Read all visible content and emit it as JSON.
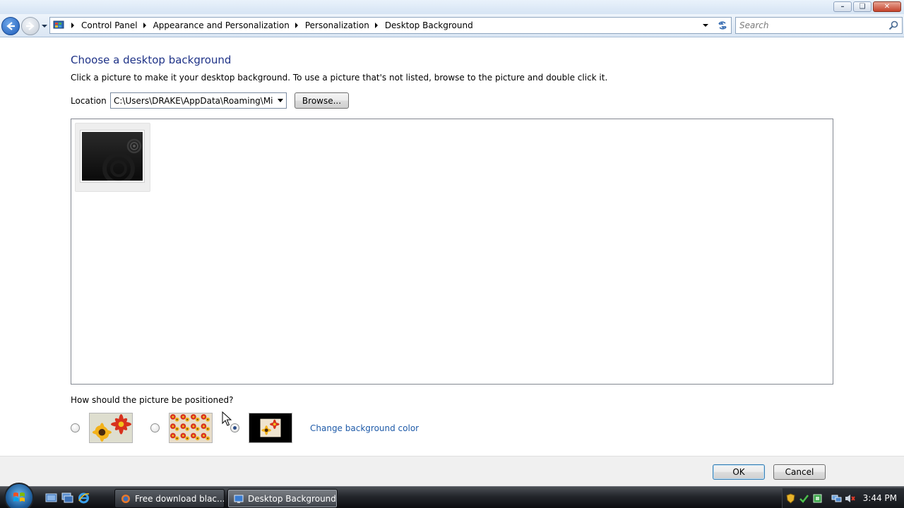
{
  "window": {
    "caption_buttons": [
      "minimize",
      "maximize",
      "close"
    ]
  },
  "navbar": {
    "breadcrumbs": [
      "Control Panel",
      "Appearance and Personalization",
      "Personalization",
      "Desktop Background"
    ],
    "search_placeholder": "Search"
  },
  "content": {
    "heading": "Choose a desktop background",
    "description": "Click a picture to make it your desktop background. To use a picture that's not listed, browse to the picture and double click it.",
    "location_label": "Location",
    "location_value": "C:\\Users\\DRAKE\\AppData\\Roaming\\Micro",
    "browse_label": "Browse...",
    "thumbnails": [
      {
        "name": "dark-circles-wallpaper",
        "selected": false
      }
    ],
    "position_question": "How should the picture be positioned?",
    "position_options": [
      {
        "icon": "fit-to-screen-icon",
        "checked": false
      },
      {
        "icon": "tile-icon",
        "checked": false
      },
      {
        "icon": "center-icon",
        "checked": true
      }
    ],
    "change_color_label": "Change background color"
  },
  "footer": {
    "ok_label": "OK",
    "cancel_label": "Cancel"
  },
  "taskbar": {
    "tasks": [
      {
        "label": "Free download blac...",
        "active": false
      },
      {
        "label": "Desktop Background",
        "active": true
      }
    ],
    "clock": "3:44 PM"
  },
  "colors": {
    "heading": "#1e3287",
    "link": "#1e5aa8",
    "accent": "#3c7fb1"
  }
}
